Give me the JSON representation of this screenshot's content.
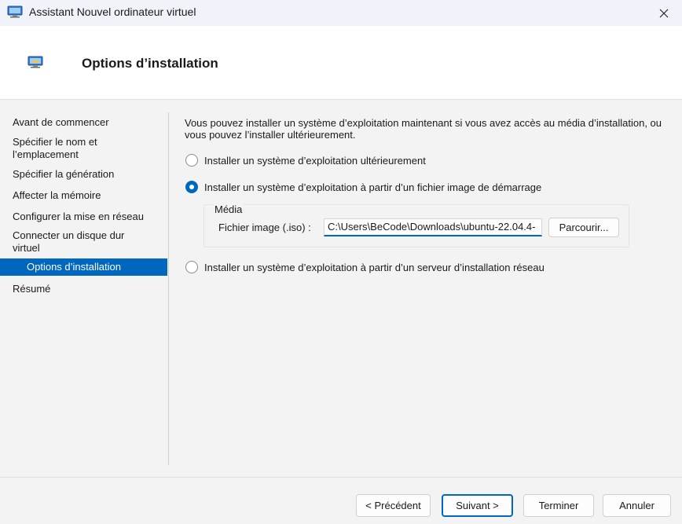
{
  "window": {
    "title": "Assistant Nouvel ordinateur virtuel",
    "close_glyph": "✕"
  },
  "header": {
    "title": "Options d’installation"
  },
  "nav": {
    "items": [
      {
        "label": "Avant de commencer",
        "active": false
      },
      {
        "label": "Spécifier le nom et l’emplacement",
        "active": false
      },
      {
        "label": "Spécifier la génération",
        "active": false
      },
      {
        "label": "Affecter la mémoire",
        "active": false
      },
      {
        "label": "Configurer la mise en réseau",
        "active": false
      },
      {
        "label": "Connecter un disque dur virtuel",
        "active": false
      },
      {
        "label": "Options d’installation",
        "active": true
      },
      {
        "label": "Résumé",
        "active": false
      }
    ]
  },
  "content": {
    "intro": "Vous pouvez installer un système d’exploitation maintenant si vous avez accès au média d’installation, ou vous pouvez l’installer ultérieurement.",
    "options": [
      {
        "label": "Installer un système d’exploitation ultérieurement",
        "checked": false
      },
      {
        "label": "Installer un système d’exploitation à partir d’un fichier image de démarrage",
        "checked": true
      },
      {
        "label": "Installer un système d’exploitation à partir d’un serveur d’installation réseau",
        "checked": false
      }
    ],
    "media": {
      "group_title": "Média",
      "field_label": "Fichier image (.iso) :",
      "path_value": "C:\\Users\\BeCode\\Downloads\\ubuntu-22.04.4-",
      "browse_label": "Parcourir..."
    }
  },
  "footer": {
    "previous": "< Précédent",
    "next": "Suivant >",
    "finish": "Terminer",
    "cancel": "Annuler"
  },
  "colors": {
    "accent": "#0067c0",
    "header_bg": "#ffffff",
    "body_bg": "#f3f3f3"
  },
  "icons": {
    "app": "monitor-icon",
    "close": "close-icon"
  }
}
